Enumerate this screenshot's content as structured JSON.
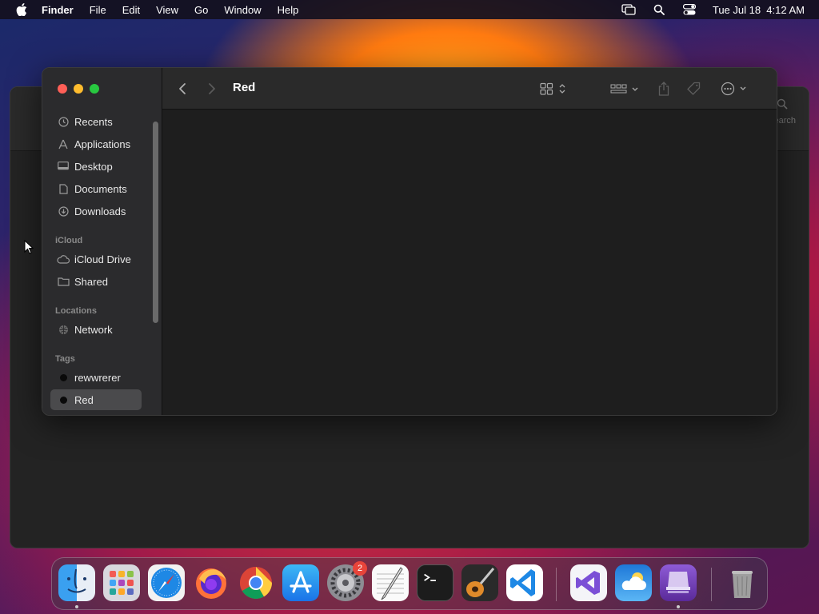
{
  "menubar": {
    "app_name": "Finder",
    "menus": [
      "File",
      "Edit",
      "View",
      "Go",
      "Window",
      "Help"
    ],
    "clock": "Tue Jul 18  4:12 AM"
  },
  "background_window": {
    "search_placeholder": "Search"
  },
  "finder": {
    "title": "Red",
    "sidebar": {
      "favorites": [
        {
          "label": "Recents",
          "icon": "clock-icon"
        },
        {
          "label": "Applications",
          "icon": "applications-icon"
        },
        {
          "label": "Desktop",
          "icon": "desktop-icon"
        },
        {
          "label": "Documents",
          "icon": "document-icon"
        },
        {
          "label": "Downloads",
          "icon": "download-icon"
        }
      ],
      "icloud_header": "iCloud",
      "icloud": [
        {
          "label": "iCloud Drive",
          "icon": "cloud-icon"
        },
        {
          "label": "Shared",
          "icon": "shared-folder-icon"
        }
      ],
      "locations_header": "Locations",
      "locations": [
        {
          "label": "Network",
          "icon": "globe-icon"
        }
      ],
      "tags_header": "Tags",
      "tags": [
        {
          "label": "rewwrerer",
          "color": "#0a0a0a"
        },
        {
          "label": "Red",
          "color": "#0a0a0a",
          "selected": true
        }
      ]
    }
  },
  "dock": {
    "apps": [
      {
        "name": "Finder",
        "running": true
      },
      {
        "name": "Launchpad"
      },
      {
        "name": "Safari"
      },
      {
        "name": "Firefox"
      },
      {
        "name": "Chrome"
      },
      {
        "name": "App Store"
      },
      {
        "name": "System Settings",
        "badge": "2"
      },
      {
        "name": "TextEdit"
      },
      {
        "name": "Terminal"
      },
      {
        "name": "GarageBand"
      },
      {
        "name": "Visual Studio Code"
      },
      {
        "name": "Visual Studio"
      },
      {
        "name": "Weather"
      },
      {
        "name": "Simulator",
        "running": true
      },
      {
        "name": "Trash"
      }
    ]
  }
}
